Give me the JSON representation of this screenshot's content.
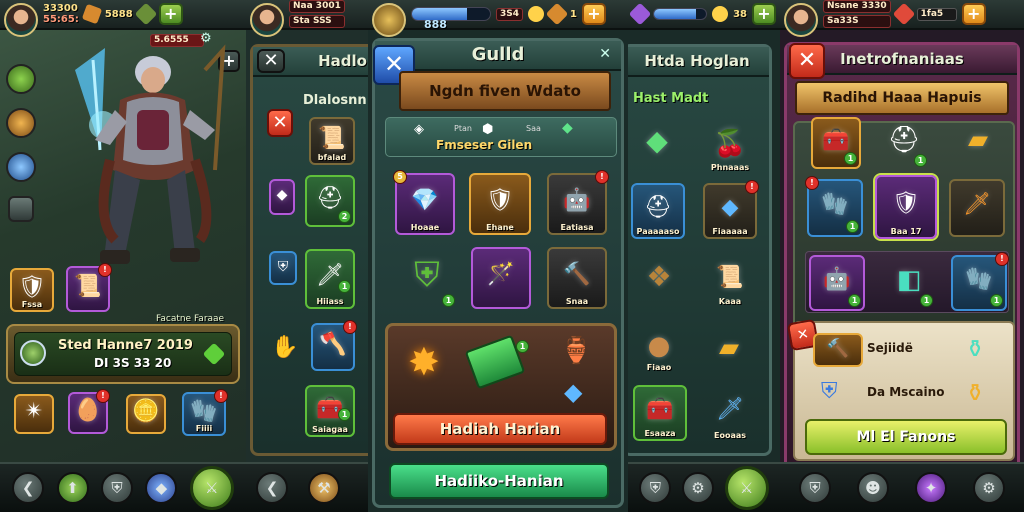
{
  "screen1": {
    "resource_gold": "33300",
    "resource_gold_sub": "55:65:",
    "gem_count": "5888",
    "timer_text": "5.6555",
    "status_title": "Sted Hanne7 2019",
    "status_sub": "DI 3S 33 20",
    "hint_text": "Facatne Faraae",
    "quick_items": [
      {
        "label": "Fssa",
        "icon": "shield-bronze"
      },
      {
        "label": "",
        "icon": "scroll-purple"
      }
    ],
    "inventory": [
      {
        "label": "",
        "icon": "spiked-gem"
      },
      {
        "label": "",
        "icon": "purple-egg"
      },
      {
        "label": "",
        "icon": "gold-coin"
      },
      {
        "label": "Fiiii",
        "icon": "blue-gauntlet"
      }
    ]
  },
  "screen2": {
    "resource": "Naa 3001",
    "resource_sub": "Sta SSS",
    "title": "Hadlo",
    "subtitle": "Dlalosnn",
    "items": [
      {
        "label": "bfalad",
        "icon": "gold-scroll"
      },
      {
        "label": "",
        "icon": "silver-helmet"
      },
      {
        "label": "Hiiass",
        "icon": "green-sword"
      },
      {
        "label": "",
        "icon": "blue-axe"
      },
      {
        "label": "Saiagaa",
        "icon": "bronze-chest"
      }
    ]
  },
  "guild": {
    "resource": "888",
    "resource_box": "3S4",
    "resource_count": "1",
    "title": "Gulld",
    "banner": "Ngdn fiven Wdato",
    "tagline": "Fmseser Gilen",
    "currency_labels": [
      "Ptan",
      "Saa"
    ],
    "grid": [
      {
        "label": "Hoaae",
        "icon": "purple-gem",
        "style": "purple"
      },
      {
        "label": "Ehane",
        "icon": "bronze-armor",
        "style": "gold"
      },
      {
        "label": "Eatiasa",
        "icon": "iron-gauntlet",
        "style": ""
      },
      {
        "label": "",
        "icon": "green-shield",
        "style": "green"
      },
      {
        "label": "",
        "icon": "purple-wand",
        "style": "purple"
      },
      {
        "label": "Snaa",
        "icon": "iron-hammer",
        "style": ""
      }
    ],
    "reward_button": "Hadiah Harian",
    "bottom_button": "Hadiiko-Hanian"
  },
  "screen4": {
    "resource": "38",
    "title": "Htda Hoglan",
    "subtitle": "Hast Madt",
    "items": [
      {
        "label": "",
        "icon": "green-crystal"
      },
      {
        "label": "Phnaaas",
        "icon": "red-berry"
      },
      {
        "label": "Paaaaaso",
        "icon": "silver-helmet"
      },
      {
        "label": "Fiaaaaa",
        "icon": "blue-crystal"
      },
      {
        "label": "",
        "icon": "brown-leaf"
      },
      {
        "label": "Kaaa",
        "icon": "gold-scroll"
      },
      {
        "label": "Fiaao",
        "icon": "bronze-orb"
      },
      {
        "label": "",
        "icon": "gold-bar"
      },
      {
        "label": "Esaaza",
        "icon": "gold-chest"
      },
      {
        "label": "Eooaas",
        "icon": "crystal-sword"
      }
    ]
  },
  "screen5": {
    "resource": "Nsane 3330",
    "resource_sub": "Sa33S",
    "resource_box": "1fa5",
    "title": "Inetrofnaniaas",
    "subtitle": "Radihd Haaa Hapuis",
    "row1": [
      {
        "label": "",
        "icon": "gold-chest"
      },
      {
        "label": "",
        "icon": "gold-helmet"
      },
      {
        "label": "",
        "icon": "gold-bar"
      }
    ],
    "row2": [
      {
        "label": "",
        "icon": "blue-gauntlet"
      },
      {
        "label": "Baa 17",
        "icon": "purple-armor"
      },
      {
        "label": "",
        "icon": "fire-sword"
      }
    ],
    "row3": [
      {
        "label": "",
        "icon": "purple-gauntlet"
      },
      {
        "label": "",
        "icon": "teal-scroll"
      },
      {
        "label": "",
        "icon": "blue-gauntlet"
      }
    ],
    "list": [
      {
        "label": "Sejiidë",
        "icon": "blue-hammer"
      },
      {
        "label": "Da Mscaino",
        "icon": "blue-shield"
      }
    ],
    "button": "Ml El Fanons"
  },
  "icons": {
    "gold": "#ffd24a",
    "gem": "#7fd8ff",
    "accent_green": "#6fc23a",
    "accent_red": "#e0312a"
  }
}
